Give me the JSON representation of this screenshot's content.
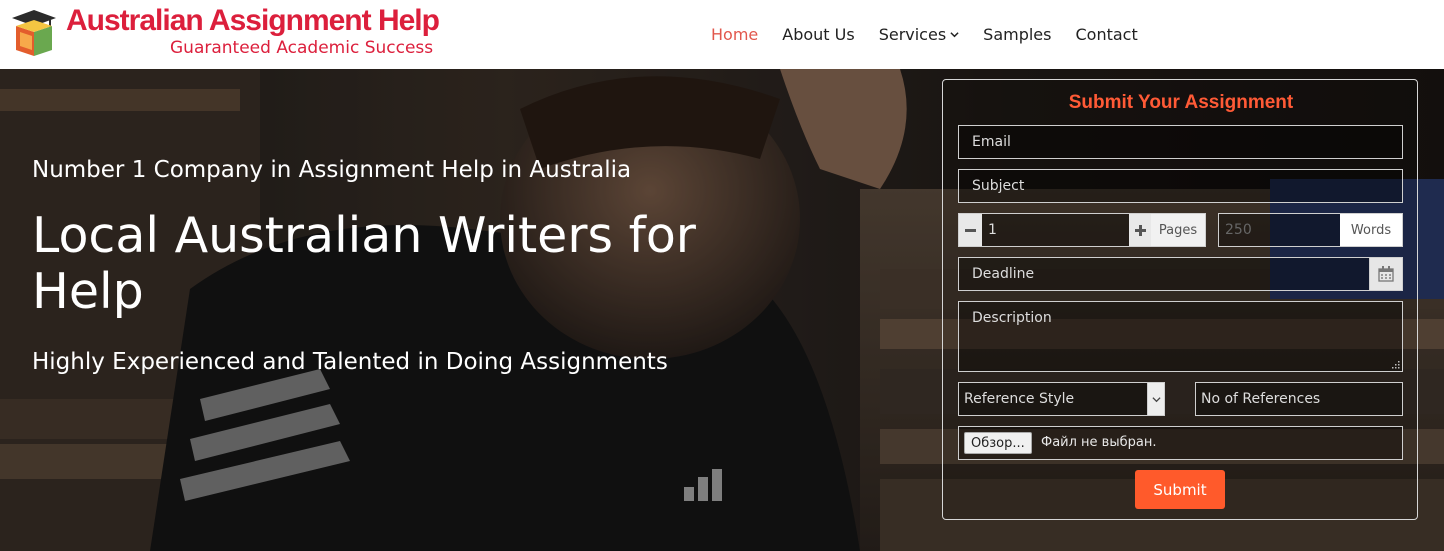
{
  "brand": {
    "name": "Australian Assignment Help",
    "tagline": "Guaranteed Academic Success",
    "accent_color": "#dc1f3c"
  },
  "nav": {
    "items": [
      {
        "label": "Home",
        "active": true
      },
      {
        "label": "About Us"
      },
      {
        "label": "Services",
        "icon": "chevron-down-icon"
      },
      {
        "label": "Samples"
      },
      {
        "label": "Contact"
      }
    ]
  },
  "hero": {
    "kicker": "Number 1 Company in Assignment Help in Australia",
    "title": "Local Australian Writers for Help",
    "subtitle": "Highly Experienced and Talented in Doing Assignments"
  },
  "form": {
    "title": "Submit Your Assignment",
    "title_color": "#ff5a36",
    "email_placeholder": "Email",
    "subject_placeholder": "Subject",
    "pages_value": "1",
    "pages_label": "Pages",
    "words_value": "250",
    "words_label": "Words",
    "deadline_placeholder": "Deadline",
    "description_placeholder": "Description",
    "reference_style": "Reference Style",
    "references_placeholder": "No of References",
    "file_button": "Обзор...",
    "file_status": "Файл не выбран.",
    "submit_label": "Submit",
    "submit_color": "#ff5a2b"
  }
}
